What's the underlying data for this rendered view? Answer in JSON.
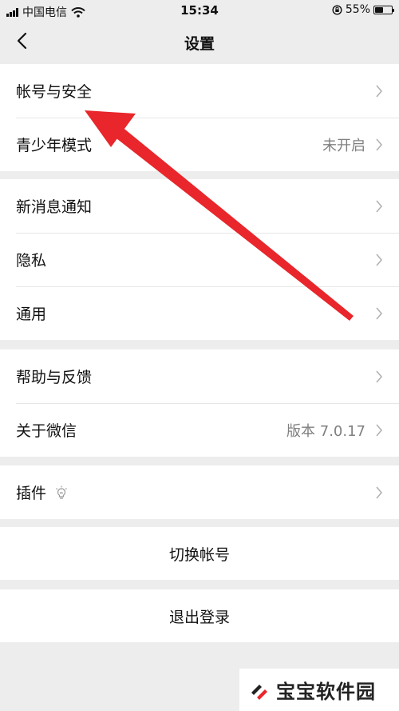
{
  "status_bar": {
    "carrier": "中国电信",
    "time": "15:34",
    "battery_percent": "55%",
    "battery_level": 0.55,
    "wifi_icon": "wifi-icon",
    "rotation_lock_icon": "rotation-lock-icon"
  },
  "nav": {
    "title": "设置",
    "back_icon": "chevron-left-icon"
  },
  "groups": [
    {
      "items": [
        {
          "label": "帐号与安全",
          "value": ""
        },
        {
          "label": "青少年模式",
          "value": "未开启"
        }
      ]
    },
    {
      "items": [
        {
          "label": "新消息通知",
          "value": ""
        },
        {
          "label": "隐私",
          "value": ""
        },
        {
          "label": "通用",
          "value": ""
        }
      ]
    },
    {
      "items": [
        {
          "label": "帮助与反馈",
          "value": ""
        },
        {
          "label": "关于微信",
          "value": "版本 7.0.17"
        }
      ]
    },
    {
      "items": [
        {
          "label": "插件",
          "value": "",
          "icon": "lightbulb-icon"
        }
      ]
    }
  ],
  "actions": {
    "switch_account": "切换帐号",
    "logout": "退出登录"
  },
  "annotation": {
    "arrow_color": "#e8262b"
  },
  "watermark": {
    "text": "宝宝软件园"
  },
  "colors": {
    "background": "#ededed",
    "card": "#ffffff",
    "secondary_text": "#808080",
    "chevron": "#b2b2b2"
  }
}
